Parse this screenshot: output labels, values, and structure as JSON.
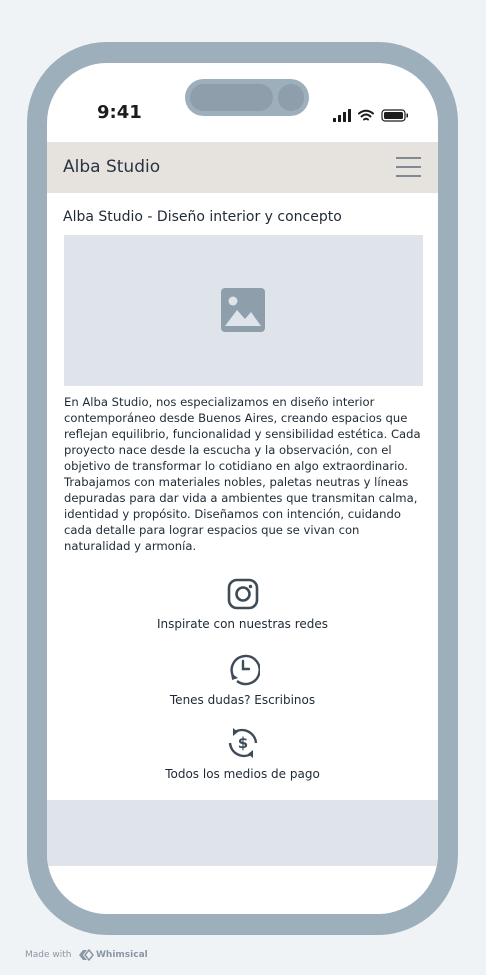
{
  "status_bar": {
    "time": "9:41"
  },
  "header": {
    "brand": "Alba Studio"
  },
  "page": {
    "title": "Alba Studio - Diseño interior y concepto",
    "description": "En Alba Studio, nos especializamos en diseño interior contemporáneo desde Buenos Aires, creando espacios que reflejan equilibrio, funcionalidad y sensibilidad estética. Cada proyecto nace desde la escucha y la observación, con el objetivo de transformar lo cotidiano en algo extraordinario. Trabajamos con materiales nobles, paletas neutras y líneas depuradas para dar vida a ambientes que transmitan calma, identidad y propósito. Diseñamos con intención, cuidando cada detalle para lograr espacios que se vivan con naturalidad y armonía."
  },
  "features": [
    {
      "icon": "instagram-icon",
      "label": "Inspirate con nuestras redes"
    },
    {
      "icon": "clock-icon",
      "label": "Tenes dudas? Escribinos"
    },
    {
      "icon": "payment-icon",
      "label": "Todos los medios de pago"
    }
  ],
  "watermark": {
    "made_with": "Made with",
    "brand": "Whimsical"
  },
  "colors": {
    "frame": "#9eafbc",
    "header_bg": "#e6e3df",
    "placeholder_bg": "#dfe3ea",
    "icon": "#3f4b57"
  }
}
